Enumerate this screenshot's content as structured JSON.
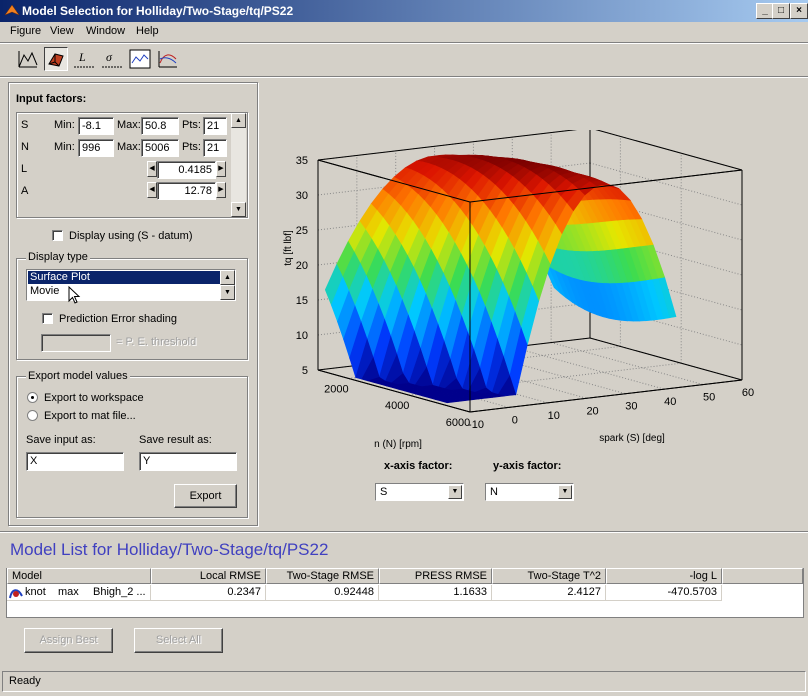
{
  "window": {
    "title": "Model Selection for Holliday/Two-Stage/tq/PS22"
  },
  "menu": [
    "Figure",
    "View",
    "Window",
    "Help"
  ],
  "toolbar": [
    "response-surface-icon",
    "3d-surface-icon",
    "likelihood-icon",
    "rmse-icon",
    "residuals-icon",
    "cross-section-icon"
  ],
  "input_factors": {
    "label": "Input factors:",
    "min_label": "Min:",
    "max_label": "Max:",
    "pts_label": "Pts:",
    "rows": [
      {
        "name": "S",
        "min": "-8.1",
        "max": "50.8",
        "pts": "21"
      },
      {
        "name": "N",
        "min": "996",
        "max": "5006",
        "pts": "21"
      }
    ],
    "fixed": [
      {
        "name": "L",
        "value": "0.4185"
      },
      {
        "name": "A",
        "value": "12.78"
      }
    ]
  },
  "display_datum": {
    "label": "Display using (S - datum)",
    "checked": false
  },
  "display_type": {
    "label": "Display type",
    "items": [
      "Surface Plot",
      "Movie"
    ],
    "selected": "Surface Plot",
    "pe_shading_label": "Prediction Error shading",
    "pe_threshold_label": "= P. E. threshold",
    "pe_threshold_value": ""
  },
  "export": {
    "label": "Export model values",
    "options": [
      "Export to workspace",
      "Export to mat file..."
    ],
    "selected": "Export to workspace",
    "save_input_label": "Save input as:",
    "save_input_value": "X",
    "save_result_label": "Save result as:",
    "save_result_value": "Y",
    "button": "Export"
  },
  "chart_data": {
    "type": "surface",
    "title": "",
    "zlabel": "tq [ft lbf]",
    "xlabel": "spark (S) [deg]",
    "ylabel": "n (N) [rpm]",
    "z_ticks": [
      "35",
      "30",
      "25",
      "20",
      "15",
      "10",
      "5"
    ],
    "x_ticks": [
      "-10",
      "0",
      "10",
      "20",
      "30",
      "40",
      "50",
      "60"
    ],
    "y_ticks": [
      "2000",
      "4000",
      "6000"
    ],
    "xlim": [
      -10,
      60
    ],
    "ylim": [
      1000,
      6000
    ],
    "zlim": [
      5,
      35
    ],
    "grid": true
  },
  "axis_factors": {
    "x_label": "x-axis factor:",
    "x_value": "S",
    "y_label": "y-axis factor:",
    "y_value": "N"
  },
  "model_list": {
    "title": "Model List for Holliday/Two-Stage/tq/PS22",
    "columns": [
      "Model",
      "Local RMSE",
      "Two-Stage RMSE",
      "PRESS RMSE",
      "Two-Stage T^2",
      "-log L"
    ],
    "rows": [
      {
        "model": "knot",
        "type": "max",
        "desc": "Bhigh_2 ...",
        "local_rmse": "0.2347",
        "ts_rmse": "0.92448",
        "press_rmse": "1.1633",
        "ts_t2": "2.4127",
        "logl": "-470.5703"
      }
    ],
    "assign_best": "Assign Best",
    "select_all": "Select All"
  },
  "status": "Ready"
}
